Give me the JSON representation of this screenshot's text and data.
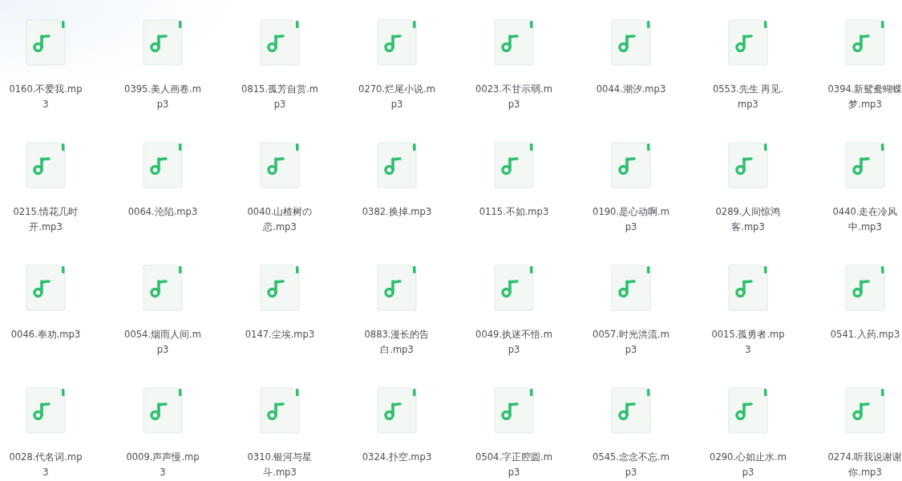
{
  "files": [
    {
      "name": "0160.不爱我.mp3"
    },
    {
      "name": "0395.美人画卷.mp3"
    },
    {
      "name": "0815.孤芳自赏.mp3"
    },
    {
      "name": "0270.烂尾小说.mp3"
    },
    {
      "name": "0023.不甘示弱.mp3"
    },
    {
      "name": "0044.潮汐.mp3"
    },
    {
      "name": "0553.先生 再见.mp3"
    },
    {
      "name": "0394.新鸳鸯蝴蝶梦.mp3"
    },
    {
      "name": "0215.情花几时开.mp3"
    },
    {
      "name": "0064.沦陷.mp3"
    },
    {
      "name": "0040.山楂树の恋.mp3"
    },
    {
      "name": "0382.换掉.mp3"
    },
    {
      "name": "0115.不如.mp3"
    },
    {
      "name": "0190.是心动啊.mp3"
    },
    {
      "name": "0289.人间惊鸿客.mp3"
    },
    {
      "name": "0440.走在冷风中.mp3"
    },
    {
      "name": "0046.奉劝.mp3"
    },
    {
      "name": "0054.烟雨人间.mp3"
    },
    {
      "name": "0147.尘埃.mp3"
    },
    {
      "name": "0883.漫长的告白.mp3"
    },
    {
      "name": "0049.执迷不悟.mp3"
    },
    {
      "name": "0057.时光洪流.mp3"
    },
    {
      "name": "0015.孤勇者.mp3"
    },
    {
      "name": "0541.入药.mp3"
    },
    {
      "name": "0028.代名词.mp3"
    },
    {
      "name": "0009.声声慢.mp3"
    },
    {
      "name": "0310.银河与星斗.mp3"
    },
    {
      "name": "0324.扑空.mp3"
    },
    {
      "name": "0504.字正腔圆.mp3"
    },
    {
      "name": "0545.念念不忘.mp3"
    },
    {
      "name": "0290.心如止水.mp3"
    },
    {
      "name": "0274.听我说谢谢你.mp3"
    }
  ]
}
